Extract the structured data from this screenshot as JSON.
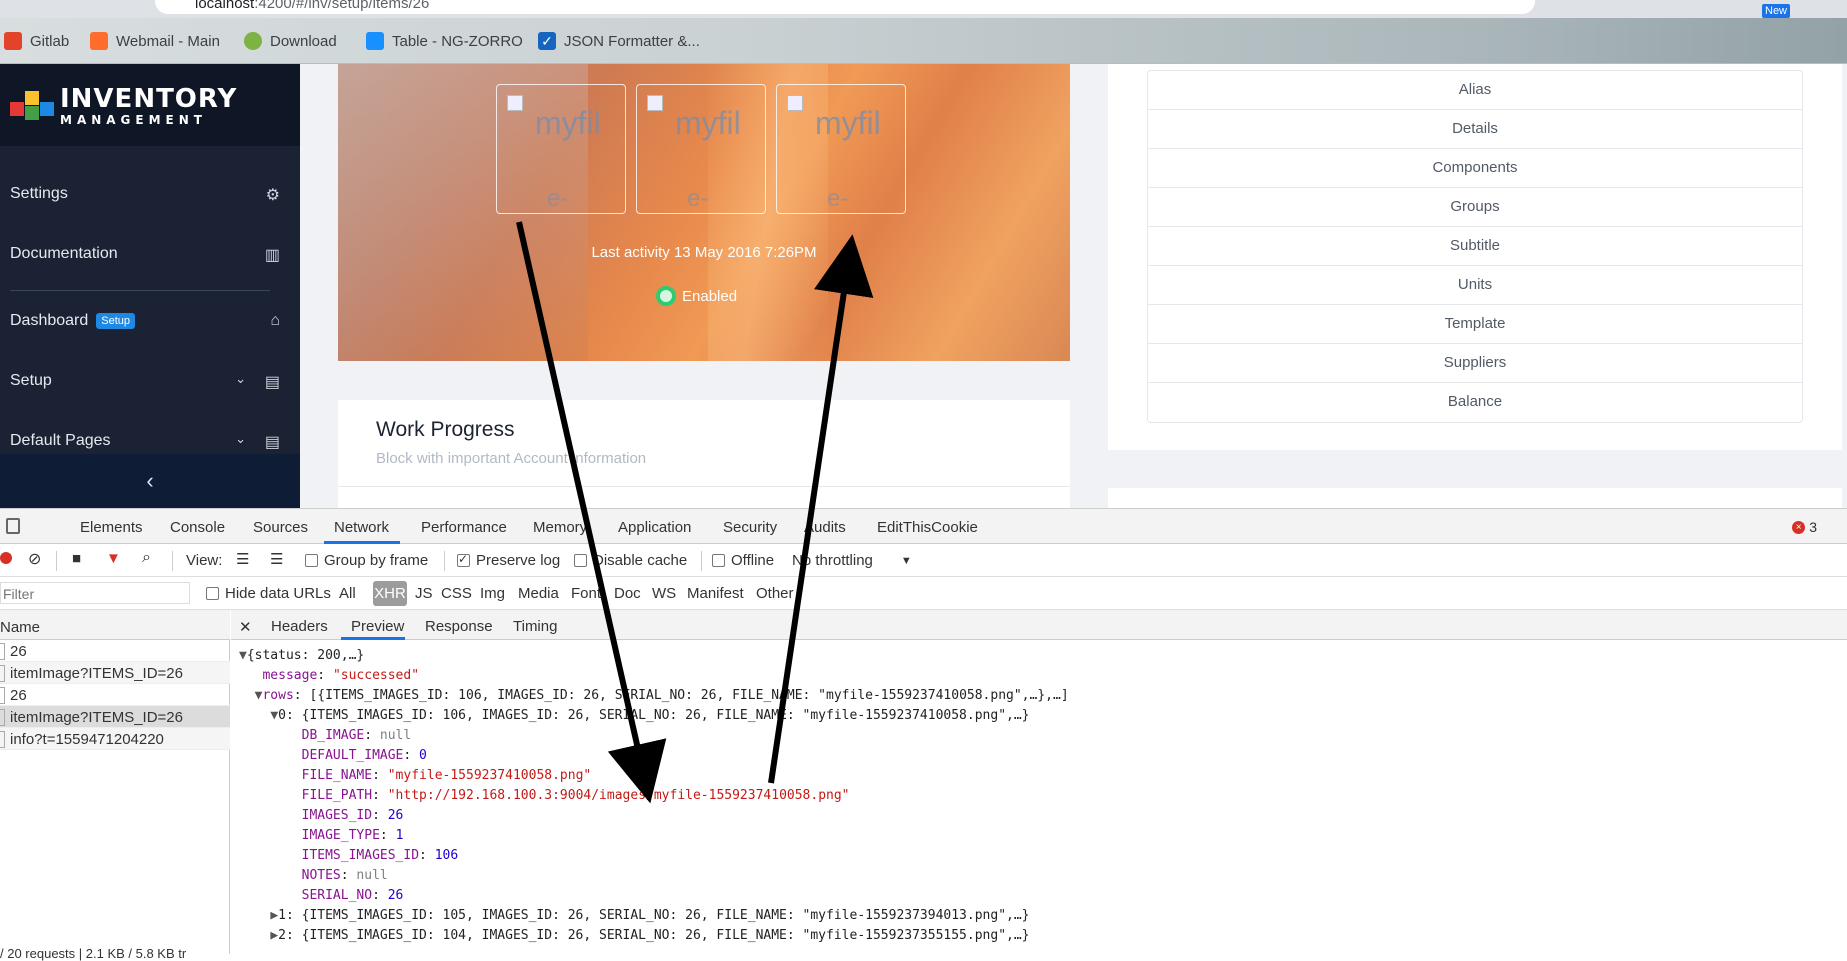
{
  "browser": {
    "url_host": "localhost",
    "url_path": ":4200/#/inv/setup/items/26",
    "bookmarks": [
      {
        "label": "Gitlab",
        "icon": "gitlab-icon"
      },
      {
        "label": "Webmail - Main",
        "icon": "cpanel-icon"
      },
      {
        "label": "Download",
        "icon": "android-icon"
      },
      {
        "label": "Table - NG-ZORRO",
        "icon": "ng-zorro-icon"
      },
      {
        "label": "JSON Formatter &...",
        "icon": "checkbox-icon"
      }
    ],
    "new_badge": "New"
  },
  "sidebar": {
    "logo_line1": "INVENTORY",
    "logo_line2": "MANAGEMENT",
    "items": [
      {
        "label": "Settings",
        "icon": "gear-icon"
      },
      {
        "label": "Documentation",
        "icon": "library-icon"
      },
      {
        "label": "Dashboard",
        "badge": "Setup",
        "icon": "home-icon"
      },
      {
        "label": "Setup",
        "icon": "list-icon"
      },
      {
        "label": "Default Pages",
        "icon": "list-icon"
      }
    ],
    "collapse_icon": "chevron-left-icon"
  },
  "hero": {
    "thumbs": [
      {
        "alt_top": "myfil",
        "alt_bottom": "e-"
      },
      {
        "alt_top": "myfil",
        "alt_bottom": "e-"
      },
      {
        "alt_top": "myfil",
        "alt_bottom": "e-"
      }
    ],
    "last_activity": "Last activity 13 May 2016 7:26PM",
    "status": "Enabled",
    "status_color": "#2ecc71"
  },
  "work_progress": {
    "title": "Work Progress",
    "subtitle": "Block with important Account information"
  },
  "menu_list": [
    "Alias",
    "Details",
    "Components",
    "Groups",
    "Subtitle",
    "Units",
    "Template",
    "Suppliers",
    "Balance"
  ],
  "devtools": {
    "tabs": [
      "Elements",
      "Console",
      "Sources",
      "Network",
      "Performance",
      "Memory",
      "Application",
      "Security",
      "Audits",
      "EditThisCookie"
    ],
    "active_tab": "Network",
    "error_count": "3",
    "toolbar": {
      "view_label": "View:",
      "group_by_frame": "Group by frame",
      "preserve_log": "Preserve log",
      "disable_cache": "Disable cache",
      "offline": "Offline",
      "throttling": "No throttling"
    },
    "filter": {
      "placeholder": "Filter",
      "hide_data_urls": "Hide data URLs",
      "types": [
        "All",
        "XHR",
        "JS",
        "CSS",
        "Img",
        "Media",
        "Font",
        "Doc",
        "WS",
        "Manifest",
        "Other"
      ],
      "selected_type": "XHR"
    },
    "requests_header": "Name",
    "requests": [
      "26",
      "itemImage?ITEMS_ID=26",
      "26",
      "itemImage?ITEMS_ID=26",
      "info?t=1559471204220"
    ],
    "requests_footer": "/ 20 requests | 2.1 KB / 5.8 KB tr",
    "detail_tabs": [
      "Headers",
      "Preview",
      "Response",
      "Timing"
    ],
    "active_detail_tab": "Preview",
    "preview": {
      "root": "{status: 200,…}",
      "message_key": "message",
      "message_val": "\"successed\"",
      "rows_key": "rows",
      "rows_summary": "[{ITEMS_IMAGES_ID: 106, IMAGES_ID: 26, SERIAL_NO: 26, FILE_NAME: \"myfile-1559237410058.png\",…},…]",
      "row0": "0: {ITEMS_IMAGES_ID: 106, IMAGES_ID: 26, SERIAL_NO: 26, FILE_NAME: \"myfile-1559237410058.png\",…}",
      "fields": [
        {
          "k": "DB_IMAGE",
          "v": "null",
          "t": "null"
        },
        {
          "k": "DEFAULT_IMAGE",
          "v": "0",
          "t": "n"
        },
        {
          "k": "FILE_NAME",
          "v": "\"myfile-1559237410058.png\"",
          "t": "s"
        },
        {
          "k": "FILE_PATH",
          "v": "\"http://192.168.100.3:9004/images/myfile-1559237410058.png\"",
          "t": "s"
        },
        {
          "k": "IMAGES_ID",
          "v": "26",
          "t": "n"
        },
        {
          "k": "IMAGE_TYPE",
          "v": "1",
          "t": "n"
        },
        {
          "k": "ITEMS_IMAGES_ID",
          "v": "106",
          "t": "n"
        },
        {
          "k": "NOTES",
          "v": "null",
          "t": "null"
        },
        {
          "k": "SERIAL_NO",
          "v": "26",
          "t": "n"
        }
      ],
      "row1": "1: {ITEMS_IMAGES_ID: 105, IMAGES_ID: 26, SERIAL_NO: 26, FILE_NAME: \"myfile-1559237394013.png\",…}",
      "row2": "2: {ITEMS_IMAGES_ID: 104, IMAGES_ID: 26, SERIAL_NO: 26, FILE_NAME: \"myfile-1559237355155.png\",…}"
    }
  }
}
